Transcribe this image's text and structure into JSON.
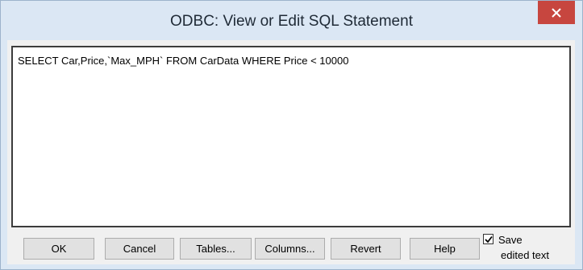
{
  "window": {
    "title": "ODBC: View or Edit SQL Statement"
  },
  "editor": {
    "text": "SELECT Car,Price,`Max_MPH` FROM CarData WHERE Price < 10000"
  },
  "buttons": {
    "ok": "OK",
    "cancel": "Cancel",
    "tables": "Tables...",
    "columns": "Columns...",
    "revert": "Revert",
    "help": "Help"
  },
  "save_option": {
    "line1": "Save",
    "line2": "edited text",
    "checked": true
  },
  "icons": {
    "close": "close-icon",
    "check": "check-icon"
  },
  "colors": {
    "title_bar": "#dbe7f4",
    "close_button": "#c7463f",
    "dialog_face": "#f0f0f0"
  }
}
